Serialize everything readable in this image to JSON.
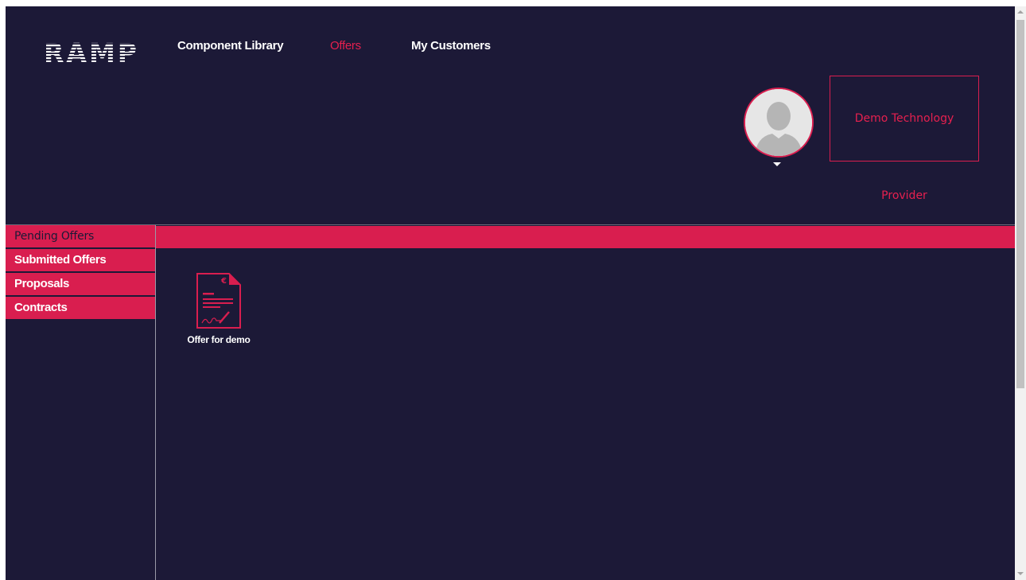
{
  "header": {
    "logo_text": "RAMP",
    "nav": [
      {
        "label": "Component Library",
        "active": false
      },
      {
        "label": "Offers",
        "active": true
      },
      {
        "label": "My Customers",
        "active": false
      }
    ],
    "company_name": "Demo Technology",
    "role": "Provider"
  },
  "sidebar": {
    "items": [
      {
        "label": "Pending Offers",
        "active": true
      },
      {
        "label": "Submitted Offers",
        "active": false
      },
      {
        "label": "Proposals",
        "active": false
      },
      {
        "label": "Contracts",
        "active": false
      }
    ]
  },
  "main": {
    "offers": [
      {
        "title": "Offer for demo",
        "icon": "offer-document-icon"
      }
    ]
  },
  "colors": {
    "background": "#1c1937",
    "accent": "#d91e4f",
    "text": "#ffffff"
  }
}
